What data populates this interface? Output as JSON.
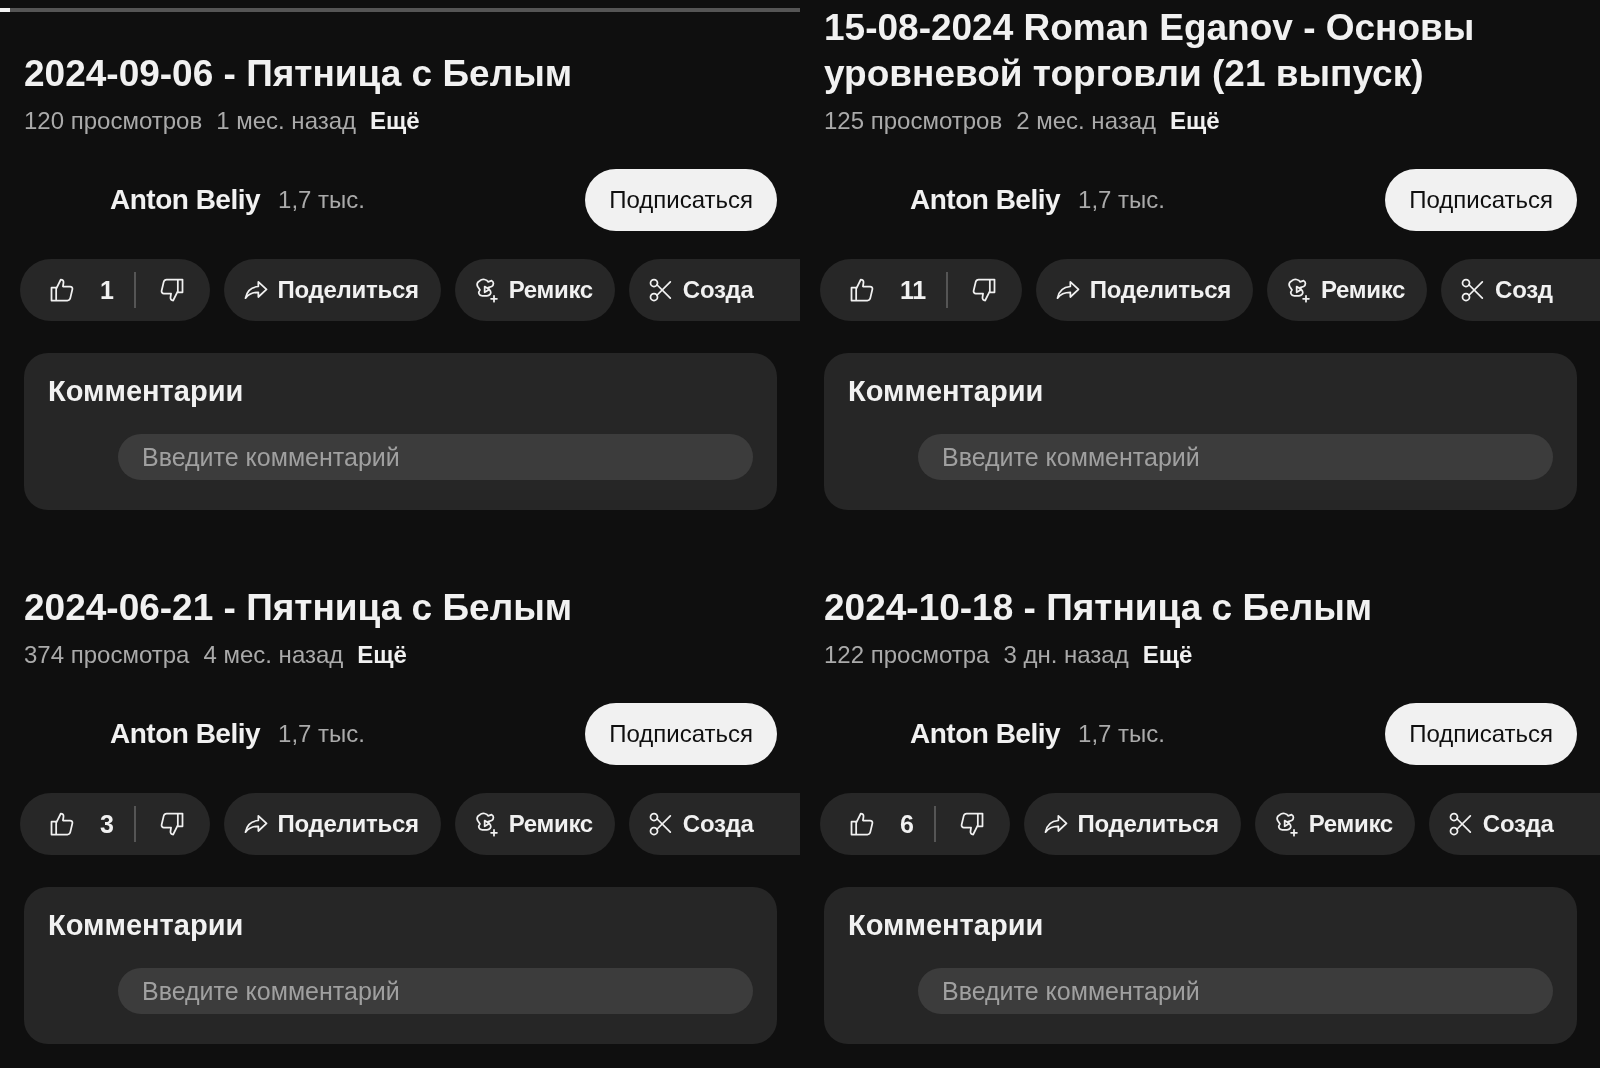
{
  "panels": [
    {
      "progress": {
        "level": 0.012
      },
      "title": "2024-09-06 - Пятница с Белым",
      "views": "120 просмотров",
      "age": "1 мес. назад",
      "more": "Ещё",
      "channel": {
        "name": "Anton Beliy",
        "subscribers": "1,7 тыс.",
        "subscribe_button": "Подписаться"
      },
      "actions": {
        "likes": "1",
        "share": "Поделиться",
        "remix": "Ремикс",
        "create": "Созда"
      },
      "comments": {
        "title": "Комментарии",
        "placeholder": "Введите комментарий"
      }
    },
    {
      "title": "2024-06-21 - Пятница с Белым",
      "views": "374 просмотра",
      "age": "4 мес. назад",
      "more": "Ещё",
      "channel": {
        "name": "Anton Beliy",
        "subscribers": "1,7 тыс.",
        "subscribe_button": "Подписаться"
      },
      "actions": {
        "likes": "3",
        "share": "Поделиться",
        "remix": "Ремикс",
        "create": "Созда"
      },
      "comments": {
        "title": "Комментарии",
        "placeholder": "Введите комментарий"
      }
    },
    {
      "title": "15-08-2024 Roman Eganov - Основы уровневой торговли (21 выпуск)",
      "views": "125 просмотров",
      "age": "2 мес. назад",
      "more": "Ещё",
      "channel": {
        "name": "Anton Beliy",
        "subscribers": "1,7 тыс.",
        "subscribe_button": "Подписаться"
      },
      "actions": {
        "likes": "11",
        "share": "Поделиться",
        "remix": "Ремикс",
        "create": "Созд"
      },
      "comments": {
        "title": "Комментарии",
        "placeholder": "Введите комментарий"
      }
    },
    {
      "title": "2024-10-18 - Пятница с Белым",
      "views": "122 просмотра",
      "age": "3 дн. назад",
      "more": "Ещё",
      "channel": {
        "name": "Anton Beliy",
        "subscribers": "1,7 тыс.",
        "subscribe_button": "Подписаться"
      },
      "actions": {
        "likes": "6",
        "share": "Поделиться",
        "remix": "Ремикс",
        "create": "Созда"
      },
      "comments": {
        "title": "Комментарии",
        "placeholder": "Введите комментарий"
      }
    }
  ]
}
